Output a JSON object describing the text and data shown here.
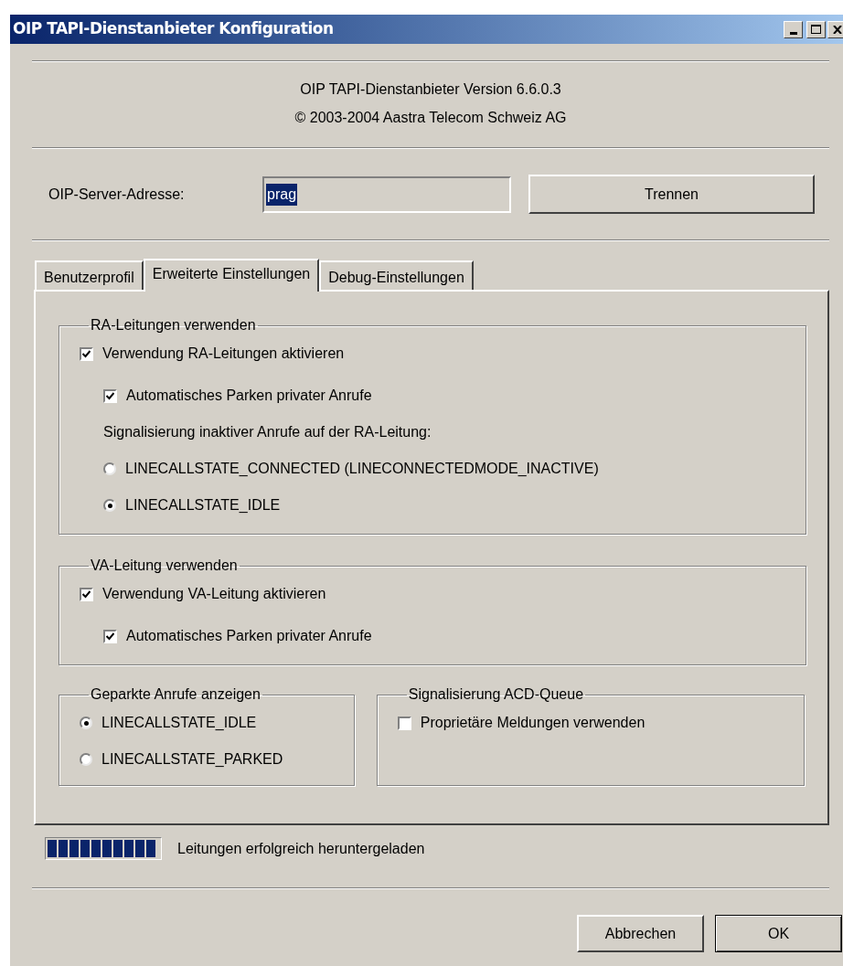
{
  "window": {
    "title": "OIP TAPI-Dienstanbieter Konfiguration"
  },
  "header": {
    "version": "OIP TAPI-Dienstanbieter Version 6.6.0.3",
    "copyright": "© 2003-2004 Aastra Telecom Schweiz AG"
  },
  "server": {
    "label": "OIP-Server-Adresse:",
    "value": "prag",
    "text_selected": true,
    "button": "Trennen"
  },
  "tabs": [
    {
      "label": "Benutzerprofil",
      "selected": false
    },
    {
      "label": "Erweiterte Einstellungen",
      "selected": true
    },
    {
      "label": "Debug-Einstellungen",
      "selected": false
    }
  ],
  "groups": [
    {
      "title": "RA-Leitungen verwenden",
      "items": [
        {
          "kind": "checkbox",
          "label": "Verwendung RA-Leitungen aktivieren",
          "checked": true,
          "children": [
            {
              "kind": "checkbox",
              "label": "Automatisches Parken privater Anrufe",
              "checked": true
            },
            {
              "kind": "text",
              "label": "Signalisierung inaktiver Anrufe auf der RA-Leitung:"
            },
            {
              "kind": "radio",
              "label": "LINECALLSTATE_CONNECTED (LINECONNECTEDMODE_INACTIVE)",
              "selected": false
            },
            {
              "kind": "radio",
              "label": "LINECALLSTATE_IDLE",
              "selected": true
            }
          ]
        }
      ]
    },
    {
      "title": "VA-Leitung verwenden",
      "items": [
        {
          "kind": "checkbox",
          "label": "Verwendung VA-Leitung aktivieren",
          "checked": true,
          "children": [
            {
              "kind": "checkbox",
              "label": "Automatisches Parken privater Anrufe",
              "checked": true
            }
          ]
        }
      ]
    }
  ],
  "group_row": [
    {
      "title": "Geparkte Anrufe anzeigen",
      "items": [
        {
          "kind": "radio",
          "label": "LINECALLSTATE_IDLE",
          "selected": true
        },
        {
          "kind": "radio",
          "label": "LINECALLSTATE_PARKED",
          "selected": false
        }
      ]
    },
    {
      "title": "Signalisierung ACD-Queue",
      "items": [
        {
          "kind": "checkbox",
          "label": "Proprietäre Meldungen verwenden",
          "checked": false
        }
      ]
    }
  ],
  "progress": {
    "level": 1,
    "message": "Leitungen erfolgreich heruntergeladen"
  },
  "buttons": [
    {
      "label": "Abbrechen",
      "default": false
    },
    {
      "label": "OK",
      "default": true
    }
  ]
}
